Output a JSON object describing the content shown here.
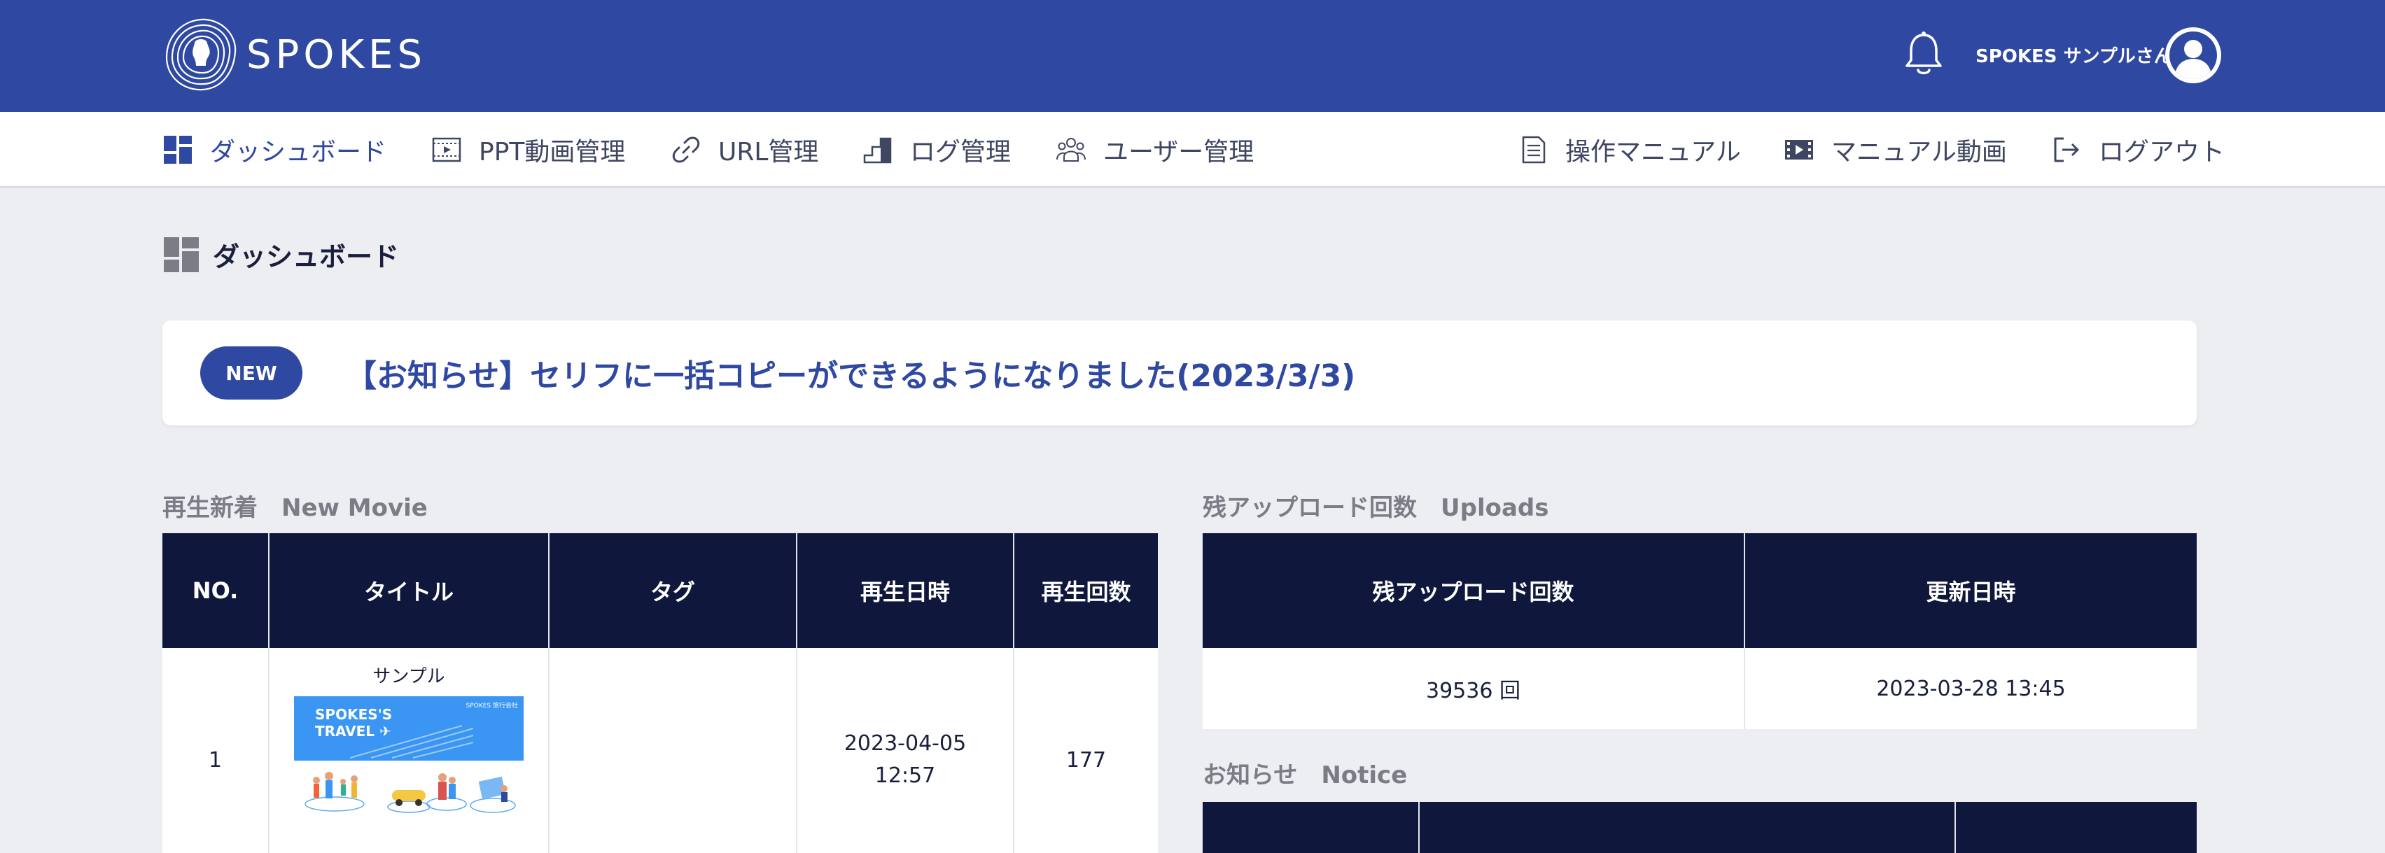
{
  "header": {
    "brand": "SPOKES",
    "user_name": "SPOKES サンプルさん"
  },
  "nav": {
    "left": [
      {
        "label": "ダッシュボード",
        "icon": "dashboard-icon",
        "active": true
      },
      {
        "label": "PPT動画管理",
        "icon": "video-frame-icon"
      },
      {
        "label": "URL管理",
        "icon": "link-icon"
      },
      {
        "label": "ログ管理",
        "icon": "steps-chart-icon"
      },
      {
        "label": "ユーザー管理",
        "icon": "users-icon"
      }
    ],
    "right": [
      {
        "label": "操作マニュアル",
        "icon": "document-icon"
      },
      {
        "label": "マニュアル動画",
        "icon": "film-icon"
      },
      {
        "label": "ログアウト",
        "icon": "logout-icon"
      }
    ]
  },
  "page": {
    "title": "ダッシュボード"
  },
  "banner": {
    "badge": "NEW",
    "text": "【お知らせ】セリフに一括コピーができるようになりました(2023/3/3)"
  },
  "new_movie": {
    "label": "再生新着　New Movie",
    "columns": [
      "NO.",
      "タイトル",
      "タグ",
      "再生日時",
      "再生回数"
    ],
    "rows": [
      {
        "no": "1",
        "title": "サンプル",
        "thumb_text": "SPOKES'S\nTRAVEL ✈",
        "thumb_small": "SPOKES 旅行会社",
        "tag": "",
        "date": "2023-04-05",
        "time": "12:57",
        "count": "177"
      }
    ]
  },
  "uploads": {
    "label": "残アップロード回数　Uploads",
    "columns": [
      "残アップロード回数",
      "更新日時"
    ],
    "row": {
      "remaining": "39536 回",
      "updated": "2023-03-28 13:45"
    }
  },
  "notice": {
    "label": "お知らせ　Notice"
  },
  "colors": {
    "header_bg": "#2f48a1",
    "table_header_bg": "#10173d",
    "accent": "#3a96f2",
    "page_bg": "#edeef1"
  }
}
